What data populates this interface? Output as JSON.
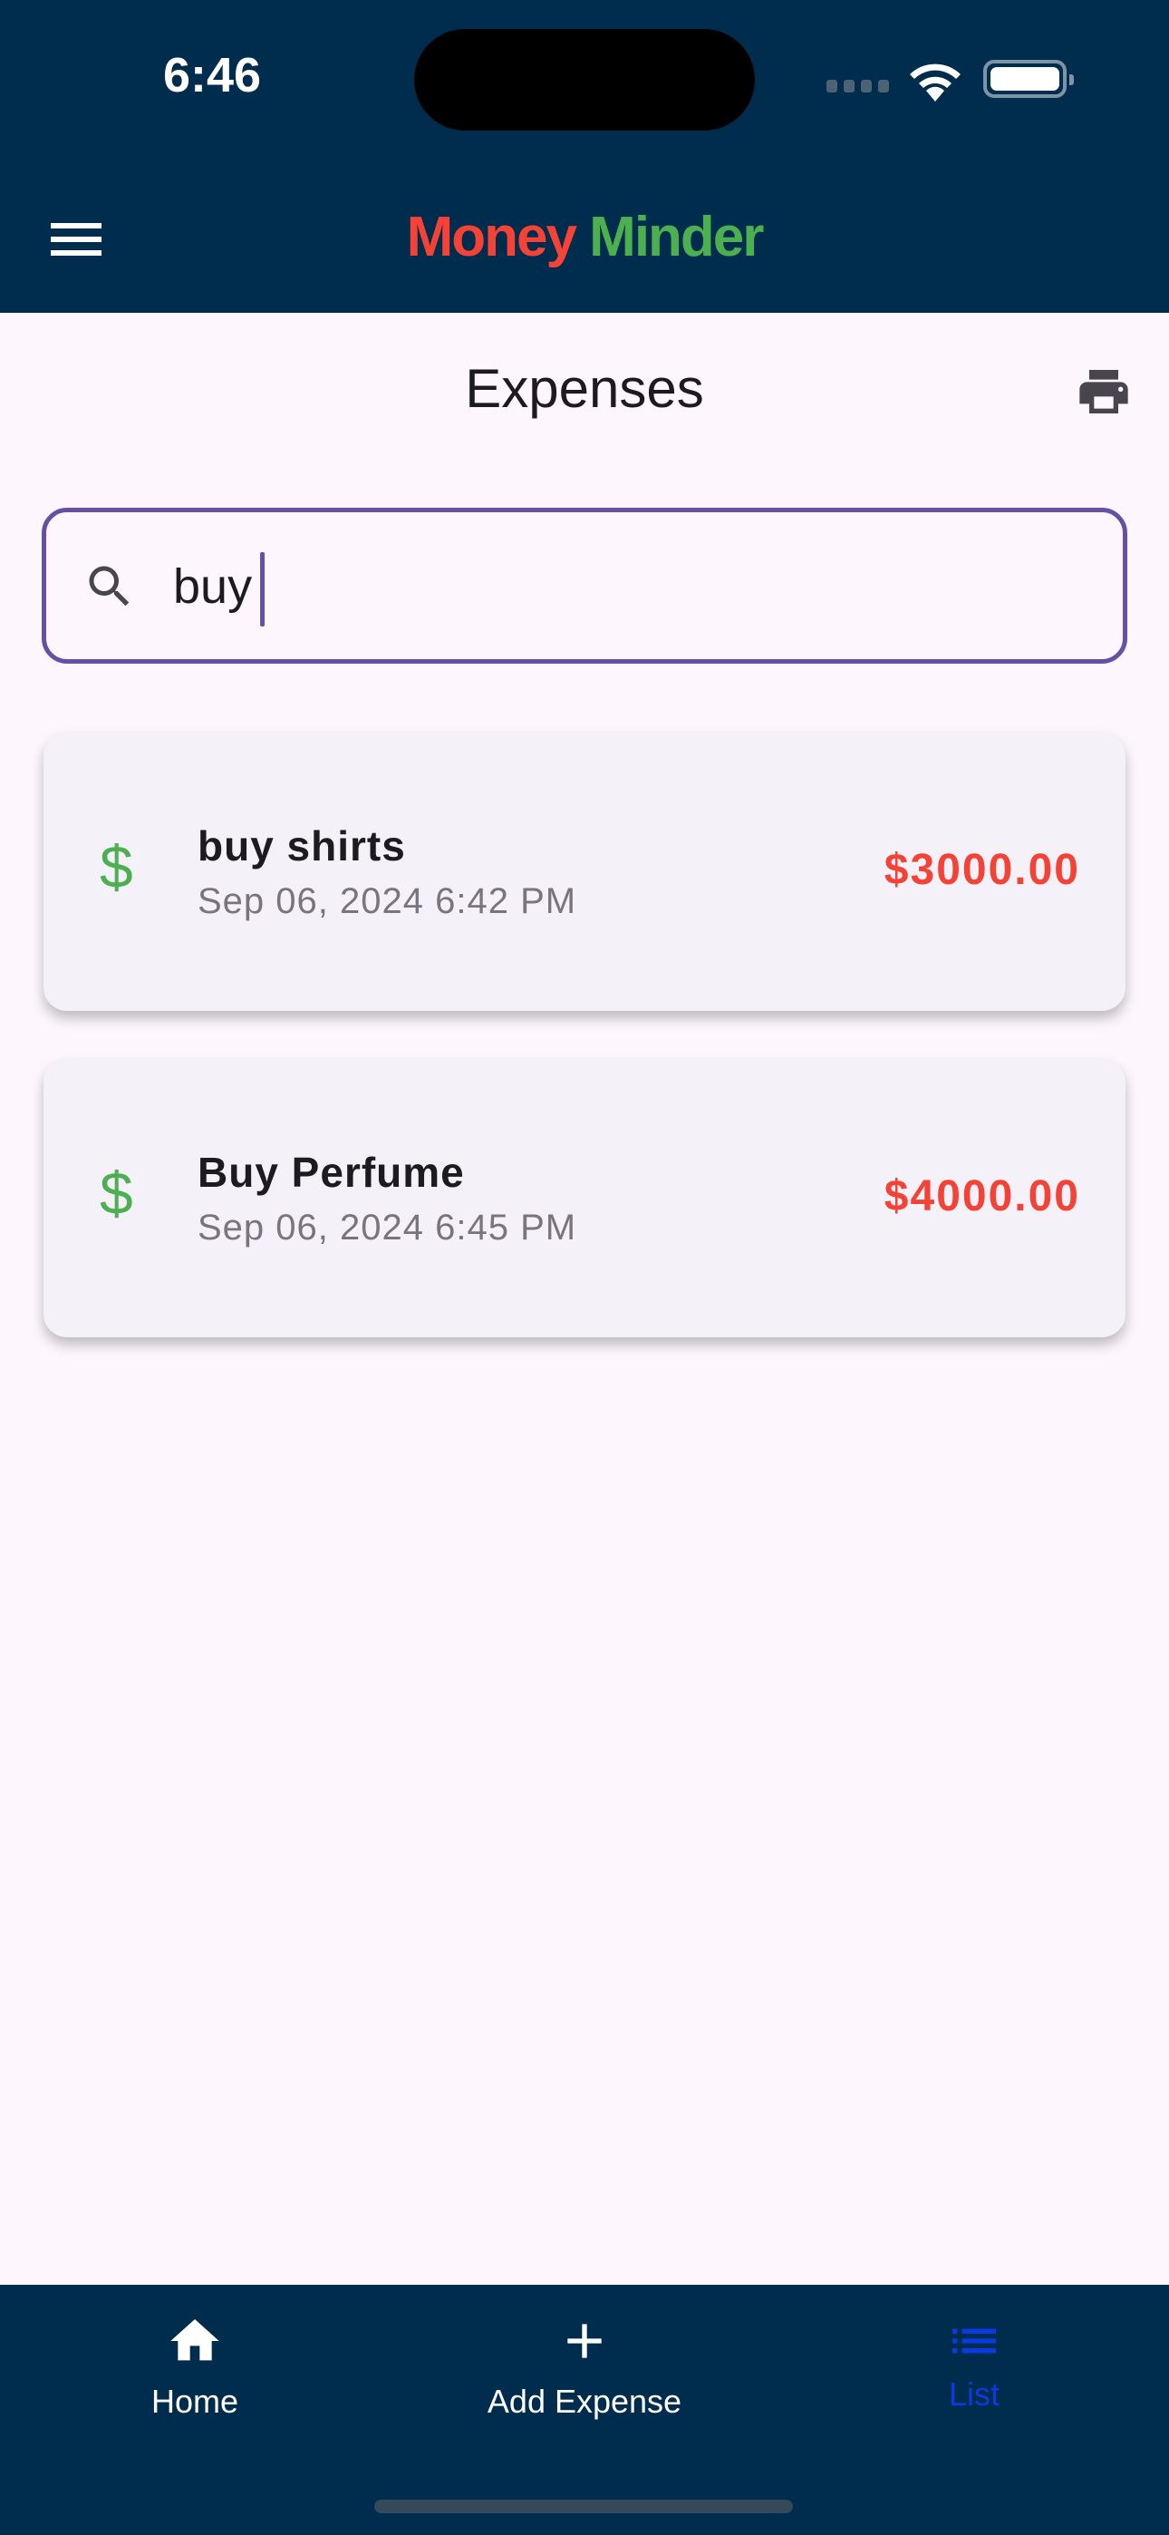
{
  "status_bar": {
    "time": "6:46"
  },
  "app_bar": {
    "title_part1": "Money",
    "title_part2": "Minder",
    "title_color1": "#f44336",
    "title_color2": "#4caf50",
    "menu_icon": "hamburger-icon"
  },
  "page": {
    "title": "Expenses",
    "print_icon": "printer-icon"
  },
  "search": {
    "value": "buy",
    "icon": "search-icon",
    "border_color": "#6750a4"
  },
  "expenses": [
    {
      "icon": "dollar-icon",
      "title": "buy shirts",
      "date": "Sep 06, 2024 6:42 PM",
      "amount": "$3000.00"
    },
    {
      "icon": "dollar-icon",
      "title": "Buy Perfume",
      "date": "Sep 06, 2024 6:45 PM",
      "amount": "$4000.00"
    }
  ],
  "bottom_nav": {
    "items": [
      {
        "label": "Home",
        "icon": "home-icon"
      },
      {
        "label": "Add Expense",
        "icon": "plus-icon"
      },
      {
        "label": "List",
        "icon": "list-icon",
        "active": true
      }
    ],
    "active_color": "#0a3be0"
  }
}
